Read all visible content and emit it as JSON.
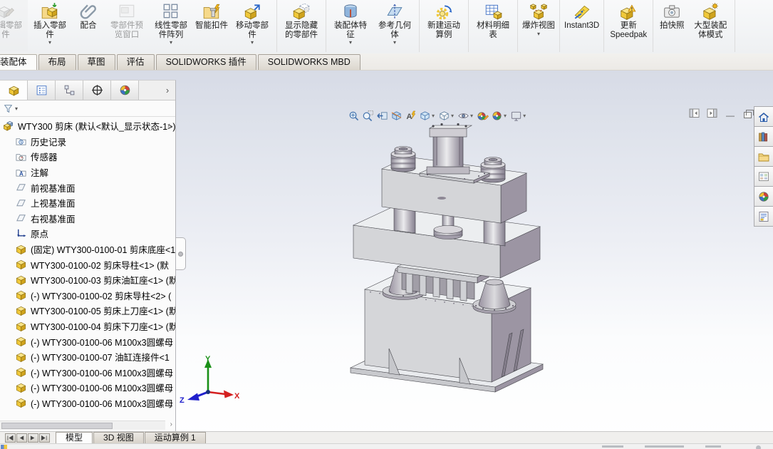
{
  "app": {
    "name": "SOLIDWORKS"
  },
  "colors": {
    "part_yellow": "#f0c83a",
    "sw_blue": "#4a78c8",
    "viewport_top": "#d7dbe6",
    "viewport_bottom": "#ffffff",
    "side_face_purple": "#9c95a3",
    "triad_x": "#d42020",
    "triad_y": "#1a9018",
    "triad_z": "#2020cc"
  },
  "ribbon": {
    "groups": [
      {
        "buttons": [
          {
            "label": "编辑零部件",
            "icon": "edit-component",
            "disabled": true
          },
          {
            "label": "插入零部件",
            "icon": "insert-component",
            "dropdown": true
          },
          {
            "label": "配合",
            "icon": "mate"
          },
          {
            "label": "零部件预览窗口",
            "icon": "preview-window",
            "disabled": true
          },
          {
            "label": "线性零部件阵列",
            "icon": "linear-pattern",
            "dropdown": true
          },
          {
            "label": "智能扣件",
            "icon": "smart-fasteners"
          },
          {
            "label": "移动零部件",
            "icon": "move-component",
            "dropdown": true
          }
        ]
      },
      {
        "buttons": [
          {
            "label": "显示隐藏的零部件",
            "icon": "show-hidden"
          }
        ]
      },
      {
        "buttons": [
          {
            "label": "装配体特征",
            "icon": "assembly-features",
            "dropdown": true
          },
          {
            "label": "参考几何体",
            "icon": "reference-geometry",
            "dropdown": true
          }
        ]
      },
      {
        "buttons": [
          {
            "label": "新建运动算例",
            "icon": "motion-study"
          }
        ]
      },
      {
        "buttons": [
          {
            "label": "材料明细表",
            "icon": "bom"
          }
        ]
      },
      {
        "buttons": [
          {
            "label": "爆炸视图",
            "icon": "exploded-view",
            "dropdown": true
          }
        ]
      },
      {
        "buttons": [
          {
            "label": "Instant3D",
            "icon": "instant3d"
          }
        ]
      },
      {
        "buttons": [
          {
            "label": "更新 Speedpak",
            "icon": "update-speedpak"
          }
        ]
      },
      {
        "buttons": [
          {
            "label": "拍快照",
            "icon": "snapshot"
          },
          {
            "label": "大型装配体模式",
            "icon": "large-assembly"
          }
        ]
      }
    ]
  },
  "command_tabs": {
    "active_index": 0,
    "tabs": [
      "装配体",
      "布局",
      "草图",
      "评估",
      "SOLIDWORKS 插件",
      "SOLIDWORKS MBD"
    ]
  },
  "headsup": {
    "buttons": [
      {
        "icon": "zoom-fit"
      },
      {
        "icon": "zoom-area"
      },
      {
        "icon": "previous-view"
      },
      {
        "icon": "section-view"
      },
      {
        "icon": "annotation-view"
      },
      {
        "icon": "view-orientation",
        "dropdown": true
      },
      {
        "icon": "display-style",
        "dropdown": true
      },
      {
        "icon": "hide-show-items",
        "dropdown": true
      },
      {
        "icon": "edit-appearance"
      },
      {
        "icon": "apply-scene",
        "dropdown": true
      },
      {
        "icon": "view-settings",
        "dropdown": true
      }
    ]
  },
  "window_controls": {
    "panes": [
      "collapse-pane-left",
      "collapse-pane-right"
    ],
    "buttons": [
      "minimize",
      "restore",
      "close"
    ]
  },
  "feature_panel": {
    "tabs": [
      {
        "icon": "featuremanager",
        "active": true
      },
      {
        "icon": "propertymanager"
      },
      {
        "icon": "configurationmanager"
      },
      {
        "icon": "dimxpertmanager"
      },
      {
        "icon": "displaymanager"
      }
    ],
    "expand_arrow": "›",
    "filter_icon": "filter-funnel-icon",
    "tree": [
      {
        "icon": "assembly",
        "label": "WTY300 剪床 (默认<默认_显示状态-1>)",
        "scroll": "up"
      },
      {
        "icon": "history",
        "label": "历史记录"
      },
      {
        "icon": "sensors",
        "label": "传感器"
      },
      {
        "icon": "annotations",
        "label": "注解"
      },
      {
        "icon": "plane",
        "label": "前视基准面"
      },
      {
        "icon": "plane",
        "label": "上视基准面"
      },
      {
        "icon": "plane",
        "label": "右视基准面"
      },
      {
        "icon": "origin",
        "label": "原点"
      },
      {
        "icon": "part",
        "label": "(固定) WTY300-0100-01 剪床底座<1"
      },
      {
        "icon": "part",
        "label": "WTY300-0100-02 剪床导柱<1> (默"
      },
      {
        "icon": "part",
        "label": "WTY300-0100-03 剪床油缸座<1> (默"
      },
      {
        "icon": "part",
        "label": "(-) WTY300-0100-02 剪床导柱<2> ("
      },
      {
        "icon": "part",
        "label": "WTY300-0100-05 剪床上刀座<1> (默"
      },
      {
        "icon": "part",
        "label": "WTY300-0100-04 剪床下刀座<1> (默"
      },
      {
        "icon": "part",
        "label": "(-) WTY300-0100-06 M100x3圆螺母"
      },
      {
        "icon": "part",
        "label": "(-) WTY300-0100-07 油缸连接件<1"
      },
      {
        "icon": "part",
        "label": "(-) WTY300-0100-06 M100x3圆螺母"
      },
      {
        "icon": "part",
        "label": "(-) WTY300-0100-06 M100x3圆螺母"
      },
      {
        "icon": "part",
        "label": "(-) WTY300-0100-06 M100x3圆螺母",
        "scroll": "down"
      }
    ]
  },
  "task_pane": {
    "icons": [
      "home",
      "design-library",
      "file-explorer",
      "view-palette",
      "appearances",
      "custom-properties"
    ]
  },
  "viewport": {
    "model_label": "WTY300 剪床",
    "triad": {
      "x": "X",
      "y": "Y",
      "z": "Z"
    }
  },
  "bottom_bar": {
    "nav_icons": [
      "first",
      "prev",
      "next",
      "last"
    ],
    "tabs": [
      {
        "label": "模型",
        "active": true
      },
      {
        "label": "3D 视图"
      },
      {
        "label": "运动算例 1"
      }
    ]
  }
}
